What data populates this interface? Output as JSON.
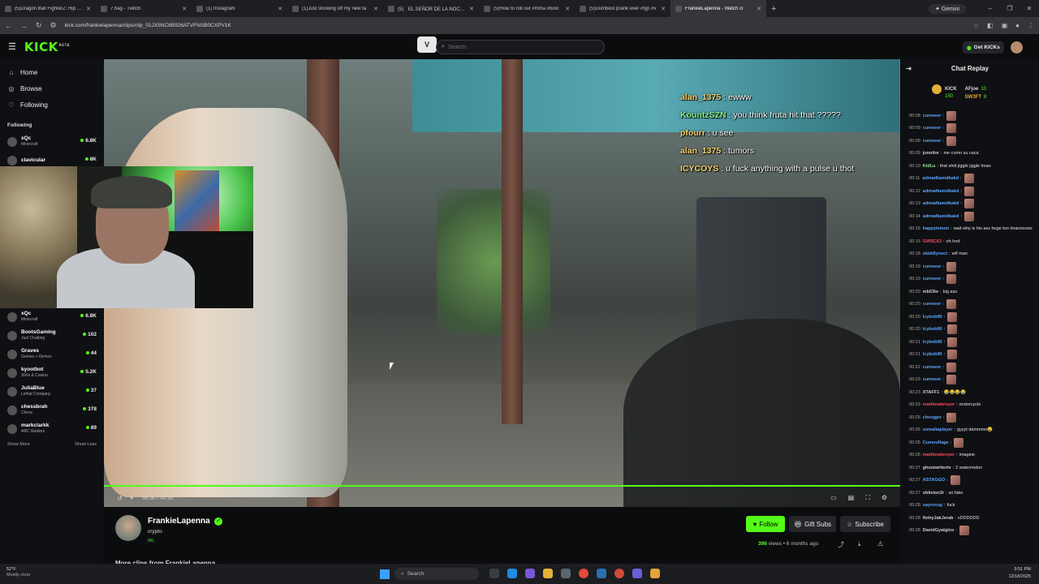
{
  "browser": {
    "tabs": [
      {
        "title": "(5)Dragon Ball FighterZ: Hip Ho",
        "active": false
      },
      {
        "title": "7 bag - Twitch",
        "active": false
      },
      {
        "title": "(1) Instagram",
        "active": false
      },
      {
        "title": "(1)Just showing off my new ta",
        "active": false
      },
      {
        "title": "(5)ﾠEL SEÑOR DE LA NOCHE",
        "active": false
      },
      {
        "title": "(5)How to roll out #mma #boxi",
        "active": false
      },
      {
        "title": "(5)Dumbest prank ever #fyp #v",
        "active": false
      },
      {
        "title": "FrankieLapenna - Watch cl",
        "active": true
      }
    ],
    "gemini_label": "Gemini",
    "url": "kick.com/frankielapenna/clips/clip_01JX5NC6B926ATVFNSB0CXPV1K"
  },
  "header": {
    "logo": "KICK",
    "logo_badge": "BETA",
    "vpn_badge": "V",
    "search_placeholder": "Search",
    "get_kicks_label": "Get KICKs"
  },
  "sidebar": {
    "nav": [
      {
        "label": "Home",
        "icon": "home-icon"
      },
      {
        "label": "Browse",
        "icon": "browse-icon"
      },
      {
        "label": "Following",
        "icon": "heart-icon"
      }
    ],
    "following_heading": "Following",
    "top_channels": [
      {
        "name": "xQc",
        "game": "Minecraft",
        "viewers": "6.8K"
      },
      {
        "name": "clavicular",
        "game": "",
        "viewers": "8K"
      }
    ],
    "channels": [
      {
        "name": "xQc",
        "game": "Minecraft",
        "viewers": "6.8K"
      },
      {
        "name": "BootsGaming",
        "game": "Just Chatting",
        "viewers": "102"
      },
      {
        "name": "Graves",
        "game": "Games + Demos",
        "viewers": "44"
      },
      {
        "name": "kyootbot",
        "game": "Slots & Casino",
        "viewers": "5.2K"
      },
      {
        "name": "JuliaBlue",
        "game": "Lethal Company",
        "viewers": "37"
      },
      {
        "name": "chessbrah",
        "game": "Chess",
        "viewers": "378"
      },
      {
        "name": "markclarkk",
        "game": "ARC Raiders",
        "viewers": "89"
      }
    ],
    "show_more": "Show More",
    "show_less": "Show Less"
  },
  "video": {
    "overlay_chat": [
      {
        "user": "alan_1375",
        "text": ": ewww",
        "color": "#f5d06a"
      },
      {
        "user": "KountzSZN",
        "text": ": you think fruta hit that ?????",
        "color": "#8cf08c"
      },
      {
        "user": "pfourr",
        "text": ": u see",
        "color": "#f5d06a"
      },
      {
        "user": "alan_1375",
        "text": ": tumors",
        "color": "#f5d06a"
      },
      {
        "user": "ICYCOYS",
        "text": ": u fuck anything with a pulse u thot",
        "color": "#f5d06a"
      }
    ],
    "time": "00:30 / 00:30",
    "progress": 1.0
  },
  "clip": {
    "streamer": "FrankieLapenna",
    "title": "crypto",
    "category": "IRL",
    "follow_label": "Follow",
    "gift_subs_label": "Gift Subs",
    "subscribe_label": "Subscribe",
    "views": "396",
    "views_suffix": " views • 6 months ago",
    "more_clips": "More clips from FrankieLapenna"
  },
  "chat": {
    "title": "Chat Replay",
    "leaderboard": {
      "label": "KICK",
      "label_value": "150",
      "top": [
        {
          "name": "AFjoe",
          "count": "10"
        },
        {
          "name": "SW3FT",
          "count": "8"
        }
      ]
    },
    "messages": [
      {
        "time": "00:08",
        "user": "cumeeer",
        "color": "#5aa5ff",
        "text": "",
        "emote": true
      },
      {
        "time": "00:09",
        "user": "cumeeer",
        "color": "#5aa5ff",
        "text": "",
        "emote": true
      },
      {
        "time": "00:09",
        "user": "cumeeer",
        "color": "#5aa5ff",
        "text": "",
        "emote": true
      },
      {
        "time": "00:09",
        "user": "junnilor",
        "color": "#d0d0d0",
        "text": "me como su caca",
        "emote": false
      },
      {
        "time": "00:10",
        "user": "KidLu",
        "color": "#8cf08c",
        "text": "that shiit jiggle jiggle lmao",
        "emote": false
      },
      {
        "time": "00:11",
        "user": "admadkamdkakd",
        "color": "#5aa5ff",
        "text": "",
        "emote": true
      },
      {
        "time": "00:12",
        "user": "admadkamdkakd",
        "color": "#5aa5ff",
        "text": "",
        "emote": true
      },
      {
        "time": "00:13",
        "user": "admadkamdkakd",
        "color": "#5aa5ff",
        "text": "",
        "emote": true
      },
      {
        "time": "00:14",
        "user": "admadkamdkakd",
        "color": "#5aa5ff",
        "text": "",
        "emote": true
      },
      {
        "time": "00:16",
        "user": "happylemon",
        "color": "#5aa5ff",
        "text": "wait why is his ass huge too lmaoooooo",
        "emote": false
      },
      {
        "time": "00:15",
        "user": "GWSC63",
        "color": "#ff4a5a",
        "text": "oh lord",
        "emote": false
      },
      {
        "time": "00:18",
        "user": "skiddlynect",
        "color": "#5aa5ff",
        "text": "wtf man",
        "emote": false
      },
      {
        "time": "00:19",
        "user": "cumeeer",
        "color": "#5aa5ff",
        "text": "",
        "emote": true
      },
      {
        "time": "00:19",
        "user": "cumeeer",
        "color": "#5aa5ff",
        "text": "",
        "emote": true
      },
      {
        "time": "00:20",
        "user": "mb53te",
        "color": "#d0d0d0",
        "text": "big ass",
        "emote": false
      },
      {
        "time": "00:20",
        "user": "cumeeer",
        "color": "#5aa5ff",
        "text": "",
        "emote": true
      },
      {
        "time": "00:20",
        "user": "lcybob90",
        "color": "#5aa5ff",
        "text": "",
        "emote": true
      },
      {
        "time": "00:20",
        "user": "lcybob90",
        "color": "#5aa5ff",
        "text": "",
        "emote": true
      },
      {
        "time": "00:21",
        "user": "lcybob90",
        "color": "#5aa5ff",
        "text": "",
        "emote": true
      },
      {
        "time": "00:21",
        "user": "lcybob90",
        "color": "#5aa5ff",
        "text": "",
        "emote": true
      },
      {
        "time": "00:22",
        "user": "cumeeer",
        "color": "#5aa5ff",
        "text": "",
        "emote": true
      },
      {
        "time": "00:23",
        "user": "cumeeer",
        "color": "#5aa5ff",
        "text": "",
        "emote": true
      },
      {
        "time": "00:23",
        "user": "XTAFF1",
        "color": "#d0d0d0",
        "text": "😂😂😂😂",
        "emote": false
      },
      {
        "time": "00:23",
        "user": "matthewbroyer",
        "color": "#ff4a5a",
        "text": "motorcycle",
        "emote": false
      },
      {
        "time": "00:25",
        "user": "chengpo",
        "color": "#5aa5ff",
        "text": "",
        "emote": true
      },
      {
        "time": "00:25",
        "user": "somaliaplayer",
        "color": "#5aa5ff",
        "text": "gyyyt dammmn😄",
        "emote": false
      },
      {
        "time": "00:26",
        "user": "Cumouflage",
        "color": "#5aa5ff",
        "text": "",
        "emote": true
      },
      {
        "time": "00:26",
        "user": "matthewbroyer",
        "color": "#ff4a5a",
        "text": "imagine",
        "emote": false
      },
      {
        "time": "00:27",
        "user": "ghostwritertv",
        "color": "#d0d0d0",
        "text": "2 watermelon",
        "emote": false
      },
      {
        "time": "00:27",
        "user": "ASTAGGO",
        "color": "#5aa5ff",
        "text": "",
        "emote": true
      },
      {
        "time": "00:27",
        "user": "oblivion3r",
        "color": "#d0d0d0",
        "text": "so fake",
        "emote": false
      },
      {
        "time": "00:28",
        "user": "sayrexug",
        "color": "#5aa5ff",
        "text": "fuck",
        "emote": false
      },
      {
        "time": "00:28",
        "user": "NohyJakJerab",
        "color": "#d0d0d0",
        "text": "xDDDDDD",
        "emote": false
      },
      {
        "time": "00:28",
        "user": "DavidGyatgins",
        "color": "#d0d0d0",
        "text": "",
        "emote": true
      }
    ]
  },
  "taskbar": {
    "weather_temp": "52°F",
    "weather_text": "Mostly clear",
    "search_placeholder": "Search",
    "time": "9:51 PM",
    "date": "12/18/2025"
  }
}
